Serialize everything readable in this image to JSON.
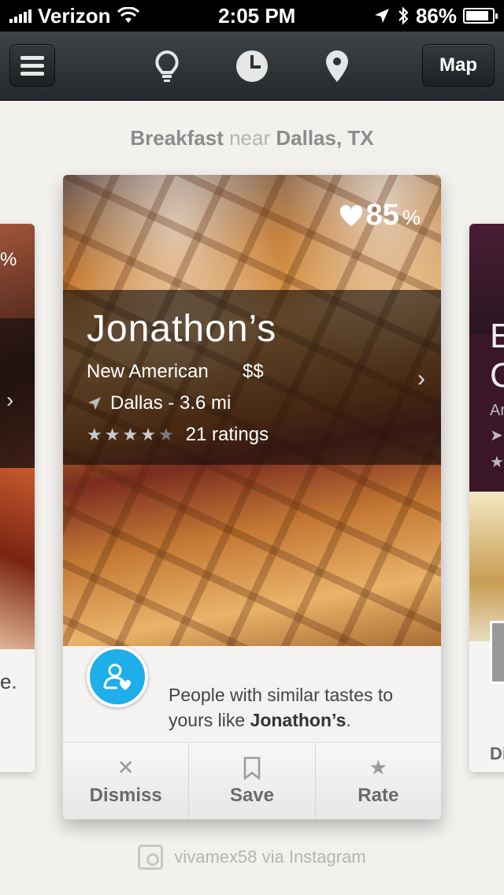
{
  "status_bar": {
    "carrier": "Verizon",
    "time": "2:05 PM",
    "battery": "86%",
    "battery_level": 0.86
  },
  "nav": {
    "map_label": "Map",
    "icons": [
      "menu-icon",
      "lightbulb-icon",
      "clock-icon",
      "location-pin-icon"
    ]
  },
  "search_context": {
    "category": "Breakfast",
    "near": "near",
    "location": "Dallas, TX"
  },
  "card": {
    "match_value": "85",
    "match_symbol": "%",
    "name": "Jonathon’s",
    "cuisine": "New American",
    "price": "$$",
    "location": "Dallas - 3.6 mi",
    "rating_stars": 4,
    "ratings_count": "21 ratings",
    "recommendation_prefix": "People with similar tastes to yours like",
    "recommendation_name": "Jonathon’s",
    "recommendation_suffix": "."
  },
  "actions": {
    "dismiss": "Dismiss",
    "save": "Save",
    "rate": "Rate"
  },
  "photo_credit": "vivamex58 via Instagram",
  "side_left": {
    "pct": "%",
    "text_fragment": "e."
  },
  "side_right": {
    "line1": "E",
    "line2": "C",
    "line3": "Ar",
    "action_fragment": "Di"
  },
  "colors": {
    "accent_blue": "#1eaee9",
    "nav_bg": "#2c3235"
  }
}
